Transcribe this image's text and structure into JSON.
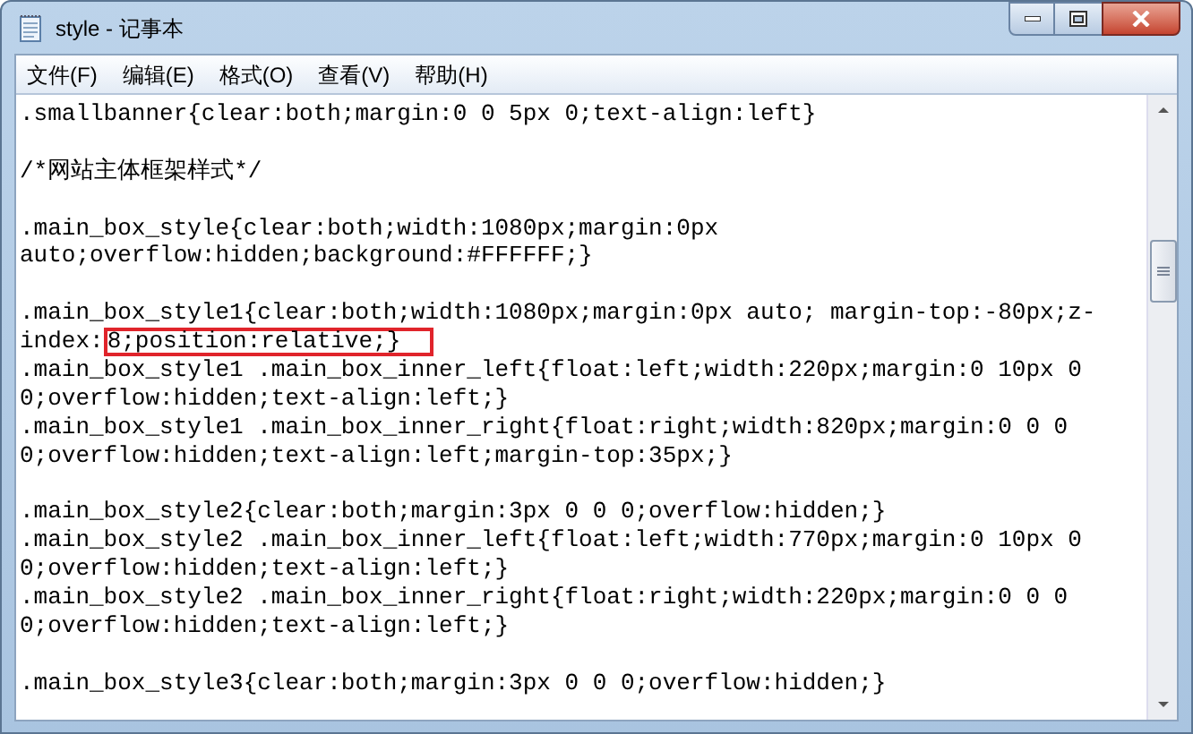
{
  "window": {
    "title": "style - 记事本"
  },
  "menu": [
    {
      "label": "文件(F)"
    },
    {
      "label": "编辑(E)"
    },
    {
      "label": "格式(O)"
    },
    {
      "label": "查看(V)"
    },
    {
      "label": "帮助(H)"
    }
  ],
  "editor": {
    "blocks": [
      [
        ".smallbanner{clear:both;margin:0 0 5px 0;text-align:left}"
      ],
      [
        "/*网站主体框架样式*/"
      ],
      [
        ".main_box_style{clear:both;width:1080px;margin:0px",
        "auto;overflow:hidden;background:#FFFFFF;}"
      ],
      [
        ".main_box_style1{clear:both;width:1080px;margin:0px auto; margin-top:-80px;z-",
        {
          "text": "index:",
          "highlighted_text": "8;position:relative;}"
        },
        ".main_box_style1 .main_box_inner_left{float:left;width:220px;margin:0 10px 0",
        "0;overflow:hidden;text-align:left;}",
        ".main_box_style1 .main_box_inner_right{float:right;width:820px;margin:0 0 0",
        "0;overflow:hidden;text-align:left;margin-top:35px;}"
      ],
      [
        ".main_box_style2{clear:both;margin:3px 0 0 0;overflow:hidden;}",
        ".main_box_style2 .main_box_inner_left{float:left;width:770px;margin:0 10px 0",
        "0;overflow:hidden;text-align:left;}",
        ".main_box_style2 .main_box_inner_right{float:right;width:220px;margin:0 0 0",
        "0;overflow:hidden;text-align:left;}"
      ],
      [
        ".main_box_style3{clear:both;margin:3px 0 0 0;overflow:hidden;}"
      ]
    ]
  }
}
